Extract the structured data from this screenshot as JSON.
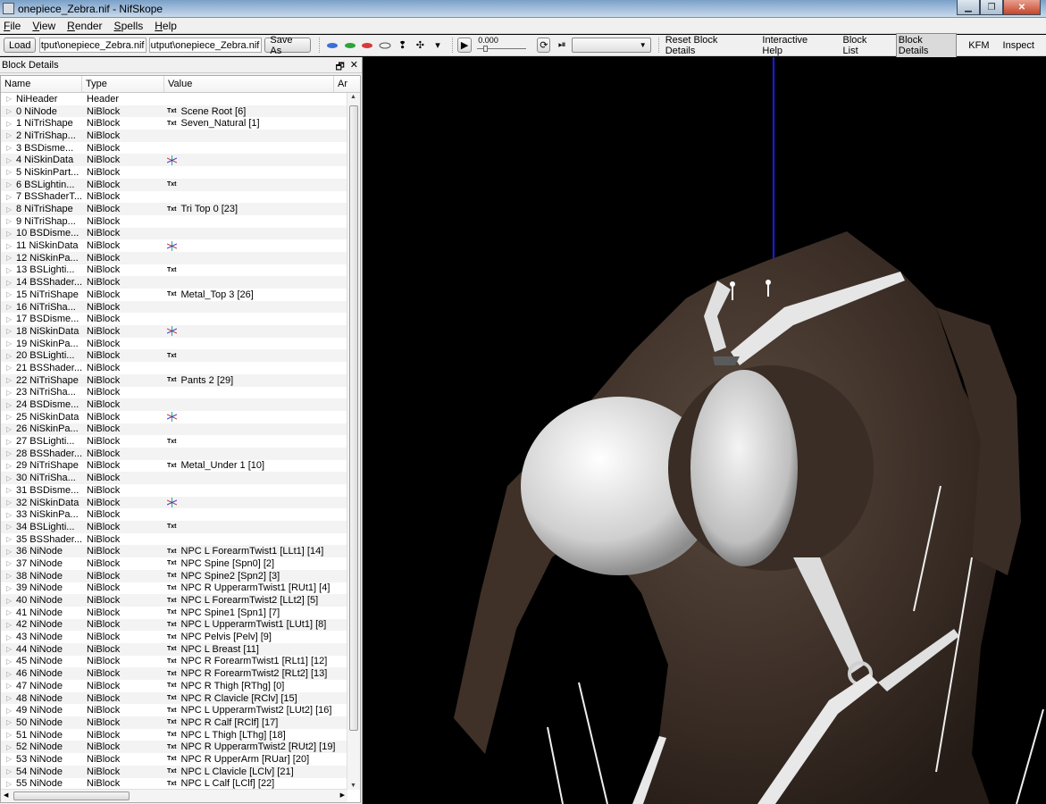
{
  "window": {
    "title": "onepiece_Zebra.nif - NifSkope"
  },
  "menu": [
    "File",
    "View",
    "Render",
    "Spells",
    "Help"
  ],
  "toolbar": {
    "load_label": "Load",
    "load_path": "output\\onepiece_Zebra.nif",
    "save_path": "output\\onepiece_Zebra.nif",
    "save_as_label": "Save As",
    "time_value": "0.000",
    "animation_selected": "",
    "links": {
      "reset": "Reset Block Details",
      "help": "Interactive Help",
      "block_list": "Block List",
      "block_details": "Block Details",
      "kfm": "KFM",
      "inspect": "Inspect"
    }
  },
  "panel": {
    "title": "Block Details",
    "columns": [
      "Name",
      "Type",
      "Value",
      "Ar"
    ],
    "rows": [
      {
        "name": "NiHeader",
        "type": "Header",
        "txt": false,
        "value": "",
        "icon": ""
      },
      {
        "name": "0 NiNode",
        "type": "NiBlock",
        "txt": true,
        "value": "Scene Root [6]",
        "icon": ""
      },
      {
        "name": "1 NiTriShape",
        "type": "NiBlock",
        "txt": true,
        "value": "Seven_Natural [1]",
        "icon": ""
      },
      {
        "name": "2 NiTriShap...",
        "type": "NiBlock",
        "txt": false,
        "value": "",
        "icon": ""
      },
      {
        "name": "3 BSDisme...",
        "type": "NiBlock",
        "txt": false,
        "value": "",
        "icon": ""
      },
      {
        "name": "4 NiSkinData",
        "type": "NiBlock",
        "txt": false,
        "value": "",
        "icon": "axes"
      },
      {
        "name": "5 NiSkinPart...",
        "type": "NiBlock",
        "txt": false,
        "value": "",
        "icon": ""
      },
      {
        "name": "6 BSLightin...",
        "type": "NiBlock",
        "txt": true,
        "value": "",
        "icon": ""
      },
      {
        "name": "7 BSShaderT...",
        "type": "NiBlock",
        "txt": false,
        "value": "",
        "icon": ""
      },
      {
        "name": "8 NiTriShape",
        "type": "NiBlock",
        "txt": true,
        "value": "Tri Top 0 [23]",
        "icon": ""
      },
      {
        "name": "9 NiTriShap...",
        "type": "NiBlock",
        "txt": false,
        "value": "",
        "icon": ""
      },
      {
        "name": "10 BSDisme...",
        "type": "NiBlock",
        "txt": false,
        "value": "",
        "icon": ""
      },
      {
        "name": "11 NiSkinData",
        "type": "NiBlock",
        "txt": false,
        "value": "",
        "icon": "axes"
      },
      {
        "name": "12 NiSkinPa...",
        "type": "NiBlock",
        "txt": false,
        "value": "",
        "icon": ""
      },
      {
        "name": "13 BSLighti...",
        "type": "NiBlock",
        "txt": true,
        "value": "",
        "icon": ""
      },
      {
        "name": "14 BSShader...",
        "type": "NiBlock",
        "txt": false,
        "value": "",
        "icon": ""
      },
      {
        "name": "15 NiTriShape",
        "type": "NiBlock",
        "txt": true,
        "value": "Metal_Top 3 [26]",
        "icon": ""
      },
      {
        "name": "16 NiTriSha...",
        "type": "NiBlock",
        "txt": false,
        "value": "",
        "icon": ""
      },
      {
        "name": "17 BSDisme...",
        "type": "NiBlock",
        "txt": false,
        "value": "",
        "icon": ""
      },
      {
        "name": "18 NiSkinData",
        "type": "NiBlock",
        "txt": false,
        "value": "",
        "icon": "axes"
      },
      {
        "name": "19 NiSkinPa...",
        "type": "NiBlock",
        "txt": false,
        "value": "",
        "icon": ""
      },
      {
        "name": "20 BSLighti...",
        "type": "NiBlock",
        "txt": true,
        "value": "",
        "icon": ""
      },
      {
        "name": "21 BSShader...",
        "type": "NiBlock",
        "txt": false,
        "value": "",
        "icon": ""
      },
      {
        "name": "22 NiTriShape",
        "type": "NiBlock",
        "txt": true,
        "value": "Pants 2 [29]",
        "icon": ""
      },
      {
        "name": "23 NiTriSha...",
        "type": "NiBlock",
        "txt": false,
        "value": "",
        "icon": ""
      },
      {
        "name": "24 BSDisme...",
        "type": "NiBlock",
        "txt": false,
        "value": "",
        "icon": ""
      },
      {
        "name": "25 NiSkinData",
        "type": "NiBlock",
        "txt": false,
        "value": "",
        "icon": "axes"
      },
      {
        "name": "26 NiSkinPa...",
        "type": "NiBlock",
        "txt": false,
        "value": "",
        "icon": ""
      },
      {
        "name": "27 BSLighti...",
        "type": "NiBlock",
        "txt": true,
        "value": "",
        "icon": ""
      },
      {
        "name": "28 BSShader...",
        "type": "NiBlock",
        "txt": false,
        "value": "",
        "icon": ""
      },
      {
        "name": "29 NiTriShape",
        "type": "NiBlock",
        "txt": true,
        "value": "Metal_Under 1 [10]",
        "icon": ""
      },
      {
        "name": "30 NiTriSha...",
        "type": "NiBlock",
        "txt": false,
        "value": "",
        "icon": ""
      },
      {
        "name": "31 BSDisme...",
        "type": "NiBlock",
        "txt": false,
        "value": "",
        "icon": ""
      },
      {
        "name": "32 NiSkinData",
        "type": "NiBlock",
        "txt": false,
        "value": "",
        "icon": "axes"
      },
      {
        "name": "33 NiSkinPa...",
        "type": "NiBlock",
        "txt": false,
        "value": "",
        "icon": ""
      },
      {
        "name": "34 BSLighti...",
        "type": "NiBlock",
        "txt": true,
        "value": "",
        "icon": ""
      },
      {
        "name": "35 BSShader...",
        "type": "NiBlock",
        "txt": false,
        "value": "",
        "icon": ""
      },
      {
        "name": "36 NiNode",
        "type": "NiBlock",
        "txt": true,
        "value": "NPC L ForearmTwist1 [LLt1] [14]",
        "icon": ""
      },
      {
        "name": "37 NiNode",
        "type": "NiBlock",
        "txt": true,
        "value": "NPC Spine [Spn0] [2]",
        "icon": ""
      },
      {
        "name": "38 NiNode",
        "type": "NiBlock",
        "txt": true,
        "value": "NPC Spine2 [Spn2] [3]",
        "icon": ""
      },
      {
        "name": "39 NiNode",
        "type": "NiBlock",
        "txt": true,
        "value": "NPC R UpperarmTwist1 [RUt1] [4]",
        "icon": ""
      },
      {
        "name": "40 NiNode",
        "type": "NiBlock",
        "txt": true,
        "value": "NPC L ForearmTwist2 [LLt2] [5]",
        "icon": ""
      },
      {
        "name": "41 NiNode",
        "type": "NiBlock",
        "txt": true,
        "value": "NPC Spine1 [Spn1] [7]",
        "icon": ""
      },
      {
        "name": "42 NiNode",
        "type": "NiBlock",
        "txt": true,
        "value": "NPC L UpperarmTwist1 [LUt1] [8]",
        "icon": ""
      },
      {
        "name": "43 NiNode",
        "type": "NiBlock",
        "txt": true,
        "value": "NPC Pelvis [Pelv] [9]",
        "icon": ""
      },
      {
        "name": "44 NiNode",
        "type": "NiBlock",
        "txt": true,
        "value": "NPC L Breast [11]",
        "icon": ""
      },
      {
        "name": "45 NiNode",
        "type": "NiBlock",
        "txt": true,
        "value": "NPC R ForearmTwist1 [RLt1] [12]",
        "icon": ""
      },
      {
        "name": "46 NiNode",
        "type": "NiBlock",
        "txt": true,
        "value": "NPC R ForearmTwist2 [RLt2] [13]",
        "icon": ""
      },
      {
        "name": "47 NiNode",
        "type": "NiBlock",
        "txt": true,
        "value": "NPC R Thigh [RThg] [0]",
        "icon": ""
      },
      {
        "name": "48 NiNode",
        "type": "NiBlock",
        "txt": true,
        "value": "NPC R Clavicle [RClv] [15]",
        "icon": ""
      },
      {
        "name": "49 NiNode",
        "type": "NiBlock",
        "txt": true,
        "value": "NPC L UpperarmTwist2 [LUt2] [16]",
        "icon": ""
      },
      {
        "name": "50 NiNode",
        "type": "NiBlock",
        "txt": true,
        "value": "NPC R Calf [RClf] [17]",
        "icon": ""
      },
      {
        "name": "51 NiNode",
        "type": "NiBlock",
        "txt": true,
        "value": "NPC L Thigh [LThg] [18]",
        "icon": ""
      },
      {
        "name": "52 NiNode",
        "type": "NiBlock",
        "txt": true,
        "value": "NPC R UpperarmTwist2 [RUt2] [19]",
        "icon": ""
      },
      {
        "name": "53 NiNode",
        "type": "NiBlock",
        "txt": true,
        "value": "NPC R UpperArm [RUar] [20]",
        "icon": ""
      },
      {
        "name": "54 NiNode",
        "type": "NiBlock",
        "txt": true,
        "value": "NPC L Clavicle [LClv] [21]",
        "icon": ""
      },
      {
        "name": "55 NiNode",
        "type": "NiBlock",
        "txt": true,
        "value": "NPC L Calf [LClf] [22]",
        "icon": ""
      }
    ],
    "txt_badge": "Txt"
  },
  "viewport": {
    "background": "#000000",
    "skin_color": "#3b2e26",
    "cloth_color": "#e8e8e8",
    "axis_color": "#1a1aff"
  },
  "icons": {
    "expand": "triangle-right",
    "float": "float-icon",
    "close": "close-icon"
  }
}
